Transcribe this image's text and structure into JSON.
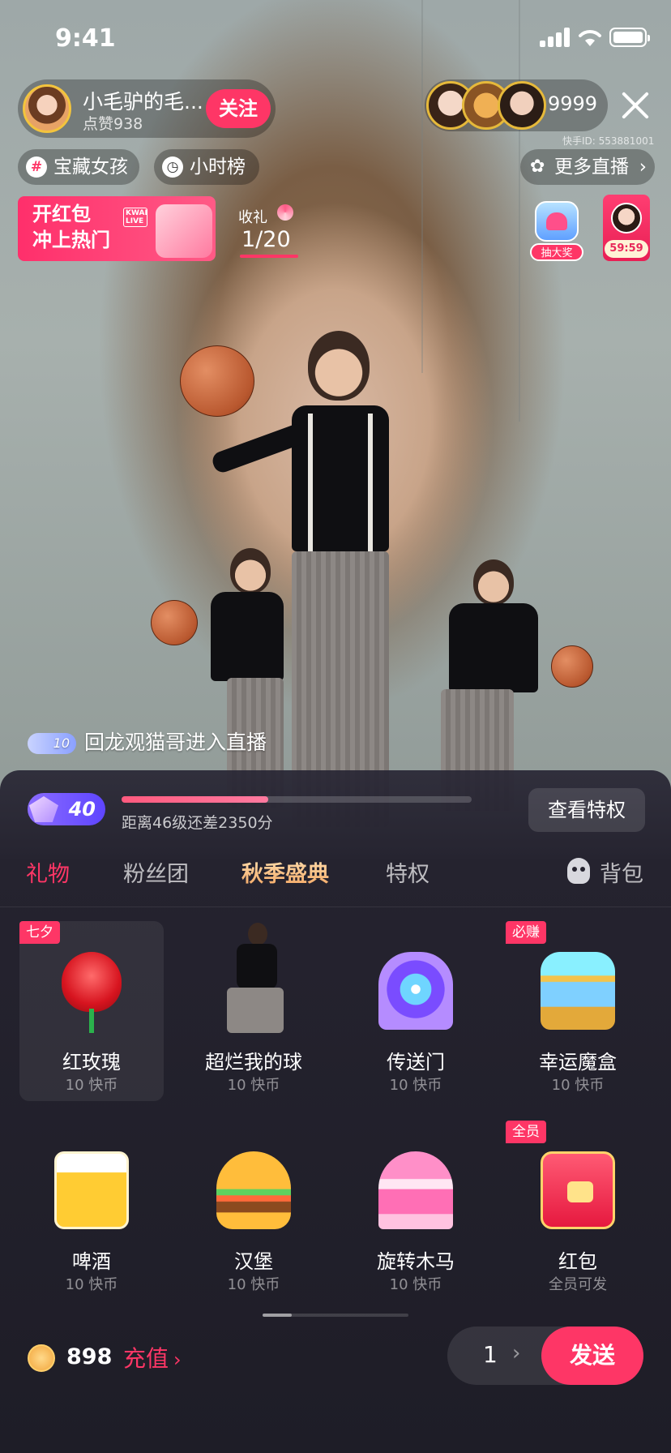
{
  "status_bar": {
    "time": "9:41"
  },
  "host": {
    "name": "小毛驴的毛...",
    "likes": "点赞938",
    "follow_label": "关注"
  },
  "viewers": {
    "count": "9999",
    "kwai_id": "快手ID: 553881001"
  },
  "chips": {
    "treasure_girl": "宝藏女孩",
    "hourly_rank": "小时榜",
    "more_live": "更多直播"
  },
  "banner": {
    "line1": "开红包",
    "line2": "冲上热门",
    "brand": "KWAI LIVE"
  },
  "gift_goal": {
    "title": "收礼",
    "progress": "1/20"
  },
  "lottery": {
    "label": "抽大奖"
  },
  "timer_card": {
    "time": "59:59"
  },
  "chat": {
    "level": "10",
    "message": "回龙观猫哥进入直播"
  },
  "panel": {
    "level": "40",
    "level_progress": 0.42,
    "level_text": "距离46级还差2350分",
    "privilege_button": "查看特权",
    "tabs": [
      "礼物",
      "粉丝团",
      "秋季盛典",
      "特权"
    ],
    "backpack": "背包",
    "gifts": [
      {
        "name": "红玫瑰",
        "price": "10 快币",
        "tag": "七夕",
        "art": "rose"
      },
      {
        "name": "超烂我的球",
        "price": "10 快币",
        "tag": "",
        "art": "dancer"
      },
      {
        "name": "传送门",
        "price": "10 快币",
        "tag": "",
        "art": "portal"
      },
      {
        "name": "幸运魔盒",
        "price": "10 快币",
        "tag": "必赚",
        "art": "chest"
      },
      {
        "name": "啤酒",
        "price": "10 快币",
        "tag": "",
        "art": "beer"
      },
      {
        "name": "汉堡",
        "price": "10 快币",
        "tag": "",
        "art": "burger"
      },
      {
        "name": "旋转木马",
        "price": "10 快币",
        "tag": "",
        "art": "carousel"
      },
      {
        "name": "红包",
        "price": "全员可发",
        "tag": "全员",
        "art": "hongbao"
      }
    ],
    "balance": "898",
    "recharge": "充值",
    "quantity": "1",
    "send": "发送"
  }
}
